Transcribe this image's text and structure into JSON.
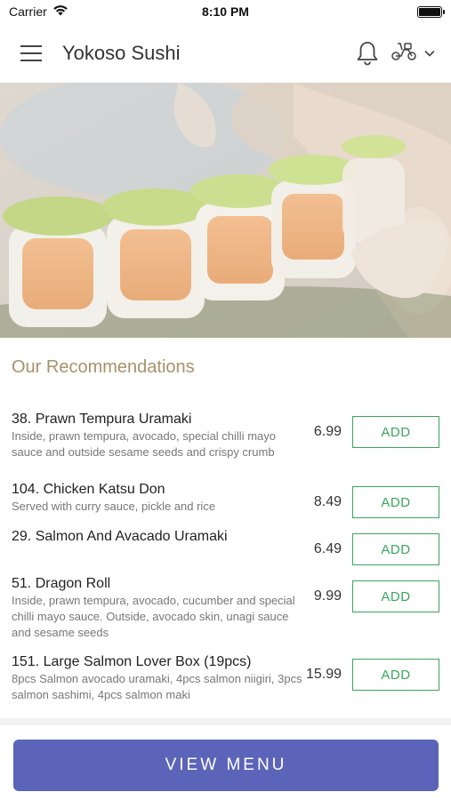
{
  "status_bar": {
    "carrier": "Carrier",
    "time": "8:10 PM",
    "battery_level": 1.0
  },
  "header": {
    "title": "Yokoso Sushi"
  },
  "section": {
    "title": "Our Recommendations"
  },
  "items": [
    {
      "name": "38. Prawn Tempura Uramaki",
      "description": "Inside, prawn tempura, avocado, special chilli mayo sauce and outside sesame seeds and crispy crumb",
      "price": "6.99",
      "add_label": "ADD"
    },
    {
      "name": "104. Chicken Katsu Don",
      "description": "Served with curry sauce, pickle and rice",
      "price": "8.49",
      "add_label": "ADD"
    },
    {
      "name": "29. Salmon And Avacado Uramaki",
      "description": "",
      "price": "6.49",
      "add_label": "ADD"
    },
    {
      "name": "51. Dragon Roll",
      "description": "Inside, prawn tempura, avocado, cucumber and special chilli mayo sauce. Outside, avocado skin, unagi sauce and sesame seeds",
      "price": "9.99",
      "add_label": "ADD"
    },
    {
      "name": "151. Large Salmon Lover Box (19pcs)",
      "description": "8pcs Salmon avocado uramaki, 4pcs salmon niigiri, 3pcs salmon sashimi, 4pcs salmon maki",
      "price": "15.99",
      "add_label": "ADD"
    }
  ],
  "footer": {
    "button_label": "VIEW MENU"
  },
  "colors": {
    "accent_gold": "#a8926a",
    "add_green": "#3aa55b",
    "primary_button": "#5b64b8"
  },
  "icons": [
    "wifi-icon",
    "battery-icon",
    "hamburger-menu-icon",
    "bell-icon",
    "scooter-icon",
    "chevron-down-icon"
  ]
}
